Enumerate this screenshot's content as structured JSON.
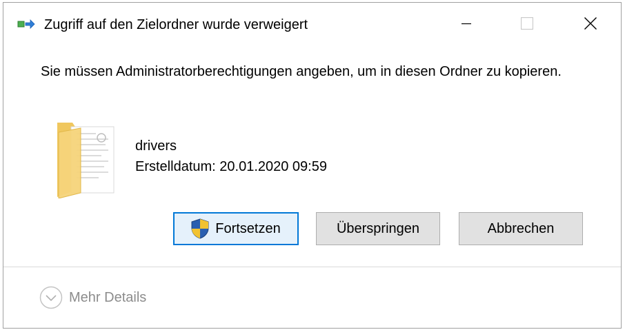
{
  "window": {
    "title": "Zugriff auf den Zielordner wurde verweigert",
    "minimize_icon": "minimize-icon",
    "maximize_icon": "maximize-icon",
    "close_icon": "close-icon"
  },
  "message": "Sie müssen Administratorberechtigungen angeben, um in diesen Ordner zu kopieren.",
  "item": {
    "icon": "folder-icon",
    "name": "drivers",
    "created": "Erstelldatum: 20.01.2020 09:59"
  },
  "buttons": {
    "continue": "Fortsetzen",
    "continue_icon": "uac-shield-icon",
    "skip": "Überspringen",
    "cancel": "Abbrechen"
  },
  "footer": {
    "details": "Mehr Details",
    "details_icon": "chevron-down-circle-icon"
  },
  "colors": {
    "primary_border": "#0078d7",
    "primary_bg": "#e5f1fb",
    "button_bg": "#e1e1e1",
    "details_text": "#8c8c8c"
  }
}
